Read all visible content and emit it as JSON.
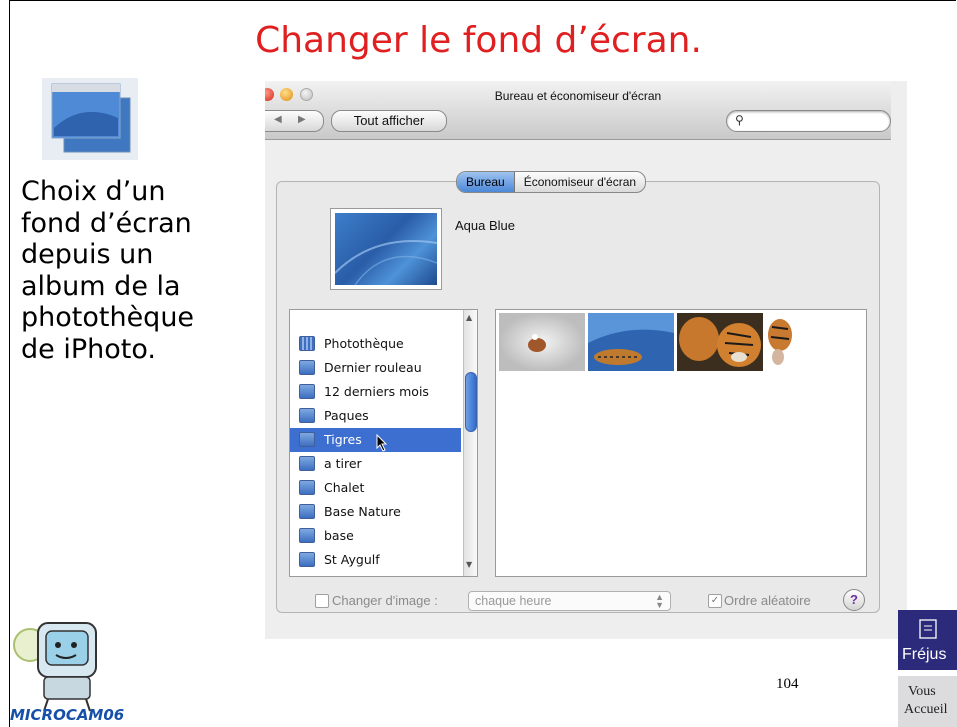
{
  "slide": {
    "title": "Changer le fond d’écran.",
    "side_text": "Choix d’un\nfond d’écran\ndepuis un\nalbum de la\nphotothèque\nde iPhoto.",
    "page_number": "104",
    "logo_left_text": "MICROCAM06",
    "logo_right_name": "Fréjus",
    "logo_right_line1": "Vous",
    "logo_right_line2": "Accueil"
  },
  "window": {
    "title": "Bureau et économiseur d'écran",
    "show_all": "Tout afficher",
    "search_placeholder": ""
  },
  "tabs": [
    {
      "label": "Bureau",
      "active": true
    },
    {
      "label": "Économiseur d'écran",
      "active": false
    }
  ],
  "current_image": {
    "name": "Aqua Blue"
  },
  "albums": [
    {
      "label": "Photothèque",
      "selected": false
    },
    {
      "label": "Dernier rouleau",
      "selected": false
    },
    {
      "label": "12 derniers mois",
      "selected": false
    },
    {
      "label": "Paques",
      "selected": false
    },
    {
      "label": "Tigres",
      "selected": true
    },
    {
      "label": "a tirer",
      "selected": false
    },
    {
      "label": "Chalet",
      "selected": false
    },
    {
      "label": "Base Nature",
      "selected": false
    },
    {
      "label": "base",
      "selected": false
    },
    {
      "label": "St Aygulf",
      "selected": false
    }
  ],
  "thumbnails": [
    "tiger-sketch",
    "tiger-on-blue",
    "tiger-face",
    "tiger-partial"
  ],
  "bottom": {
    "change_label": "Changer d'image :",
    "change_checked": false,
    "interval": "chaque heure",
    "random_label": "Ordre aléatoire",
    "random_checked": true,
    "help": "?"
  },
  "colors": {
    "title": "#e02020",
    "selection": "#3d6fd0"
  }
}
